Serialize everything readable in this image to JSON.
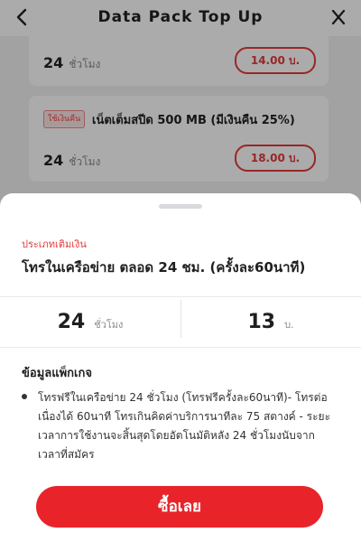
{
  "header": {
    "title": "Data Pack Top Up",
    "back_icon": "chevron-left-icon",
    "close_icon": "close-icon"
  },
  "background_cards": [
    {
      "hours": "24",
      "hours_unit": "ชั่วโมง",
      "price": "14.00 บ."
    },
    {
      "badge": "ใช้เงินคืน",
      "title": "เน็ตเต็มสปีด 500 MB (มีเงินคืน 25%)",
      "hours": "24",
      "hours_unit": "ชั่วโมง",
      "price": "18.00 บ."
    }
  ],
  "sheet": {
    "category": "ประเภทเติมเงิน",
    "title": "โทรในเครือข่าย ตลอด 24 ชม. (ครั้งละ60นาที)",
    "duration": {
      "value": "24",
      "unit": "ชั่วโมง"
    },
    "price": {
      "value": "13",
      "unit": "บ."
    },
    "info_title": "ข้อมูลแพ็กเกจ",
    "info_items": [
      "โทรฟรีในเครือข่าย 24 ชั่วโมง (โทรฟรีครั้งละ60นาที)- โทรต่อเนื่องได้ 60นาที โทรเกินคิดค่าบริการนาทีละ 75 สตางค์ - ระยะเวลาการใช้งานจะสิ้นสุดโดยอัตโนมัติหลัง 24 ชั่วโมงนับจากเวลาที่สมัคร"
    ],
    "buy_label": "ซื้อเลย"
  },
  "colors": {
    "accent": "#e8242a",
    "overlay": "rgba(0,0,0,0.33)"
  }
}
